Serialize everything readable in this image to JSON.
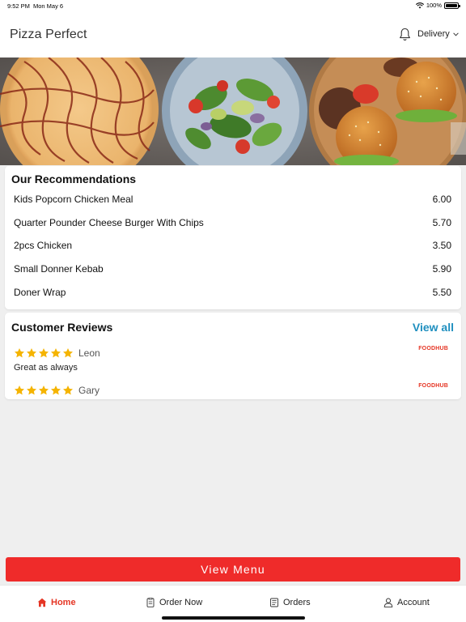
{
  "status_bar": {
    "time": "9:52 PM",
    "date": "Mon May 6",
    "battery": "100%"
  },
  "header": {
    "title": "Pizza Perfect",
    "delivery_label": "Delivery"
  },
  "recommendations": {
    "title": "Our Recommendations",
    "items": [
      {
        "name": "Kids Popcorn Chicken Meal",
        "price": "6.00"
      },
      {
        "name": "Quarter Pounder Cheese Burger With Chips",
        "price": "5.70"
      },
      {
        "name": "2pcs Chicken",
        "price": "3.50"
      },
      {
        "name": "Small Donner Kebab",
        "price": "5.90"
      },
      {
        "name": "Doner Wrap",
        "price": "5.50"
      }
    ]
  },
  "reviews": {
    "title": "Customer Reviews",
    "view_all": "View all",
    "items": [
      {
        "rating": 5,
        "reviewer": "Leon",
        "comment": "Great as always",
        "source": "FOODHUB"
      },
      {
        "rating": 5,
        "reviewer": "Gary",
        "comment": "",
        "source": "FOODHUB"
      }
    ]
  },
  "view_menu_label": "View Menu",
  "tabs": [
    {
      "label": "Home",
      "icon": "home-icon",
      "active": true
    },
    {
      "label": "Order Now",
      "icon": "order-icon",
      "active": false
    },
    {
      "label": "Orders",
      "icon": "receipt-icon",
      "active": false
    },
    {
      "label": "Account",
      "icon": "user-icon",
      "active": false
    }
  ],
  "colors": {
    "accent": "#ef2b2a",
    "link": "#1f8fbf",
    "star": "#f5b400"
  }
}
